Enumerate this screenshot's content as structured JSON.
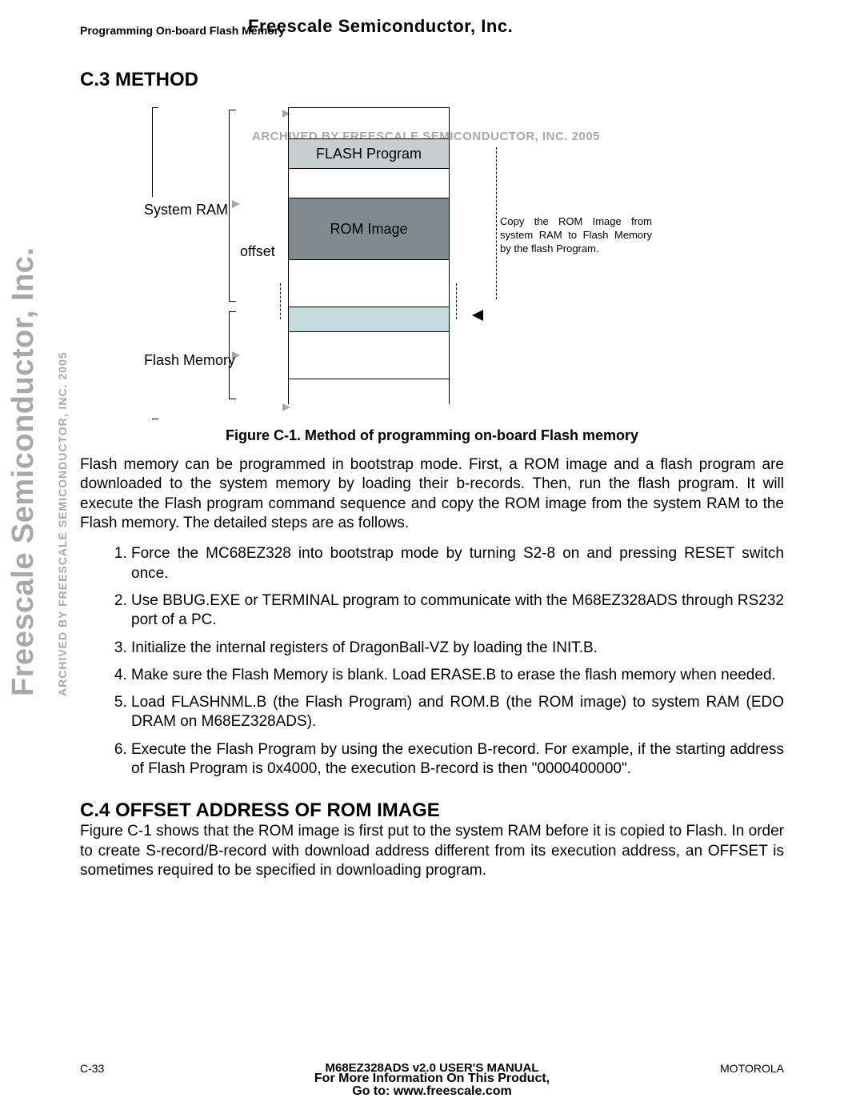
{
  "header": {
    "left": "Programming On-board Flash Memory",
    "overlay": "Freescale Semiconductor, Inc."
  },
  "section_c3": {
    "heading": "C.3 METHOD"
  },
  "diagram": {
    "watermark": "ARCHIVED BY FREESCALE SEMICONDUCTOR, INC. 2005",
    "labels": {
      "system_ram": "System RAM",
      "offset": "offset",
      "flash_memory": "Flash Memory",
      "flash_program": "FLASH Program",
      "rom_image": "ROM Image"
    },
    "note": "Copy the ROM Image from system RAM to Flash Memory by the flash Program."
  },
  "figure_caption": "Figure C-1. Method of programming on-board Flash memory",
  "paragraph_c3": "Flash memory can be programmed in bootstrap mode. First, a ROM image and a flash program are downloaded to the system memory by loading their b-records. Then, run the flash program. It will execute the Flash program command sequence and copy the ROM image from the system RAM to the Flash memory. The detailed steps are as follows.",
  "steps": [
    "Force the MC68EZ328 into bootstrap mode by turning S2-8 on and pressing RESET switch once.",
    "Use BBUG.EXE or TERMINAL program to communicate with the M68EZ328ADS through RS232 port of a PC.",
    "Initialize the internal registers of DragonBall-VZ by loading the INIT.B.",
    "Make sure the Flash Memory is blank. Load ERASE.B to erase the flash memory when needed.",
    "Load FLASHNML.B (the Flash Program) and ROM.B (the ROM image) to system RAM (EDO DRAM on M68EZ328ADS).",
    "Execute the Flash Program by using the execution B-record. For example, if the starting address of Flash Program is 0x4000, the execution B-record is then \"0000400000\"."
  ],
  "section_c4": {
    "heading": "C.4 OFFSET ADDRESS OF ROM IMAGE",
    "paragraph": "Figure C-1 shows that the ROM image is first put to the system RAM before it is copied to Flash. In order to create S-record/B-record with download address different from its execution address, an OFFSET is sometimes required to be specified in downloading program."
  },
  "footer": {
    "page_number": "C-33",
    "manual": "M68EZ328ADS v2.0 USER'S MANUAL",
    "brand": "MOTOROLA",
    "info": "For More Information On This Product,",
    "goto": "Go to: www.freescale.com"
  },
  "side_watermark_big": "Freescale Semiconductor, Inc.",
  "side_watermark_small": "ARCHIVED BY FREESCALE SEMICONDUCTOR, INC. 2005"
}
